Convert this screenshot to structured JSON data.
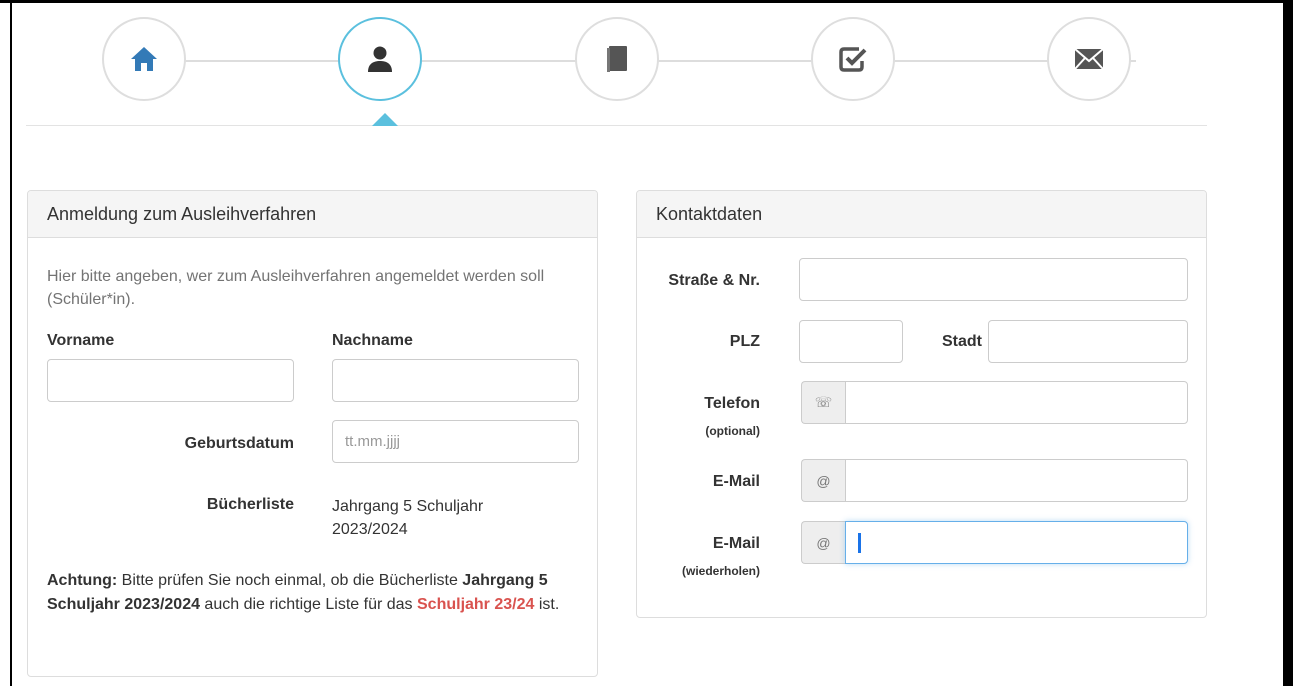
{
  "wizard": {
    "steps": [
      {
        "icon": "home-icon"
      },
      {
        "icon": "user-icon",
        "active": true
      },
      {
        "icon": "book-icon"
      },
      {
        "icon": "checkbox-icon"
      },
      {
        "icon": "envelope-icon"
      }
    ],
    "active_color": "#5bc0de"
  },
  "registration": {
    "heading": "Anmeldung zum Ausleihverfahren",
    "help_text": "Hier bitte angeben, wer zum Ausleihverfahren angemeldet werden soll (Schüler*in).",
    "firstname_label": "Vorname",
    "firstname_value": "",
    "lastname_label": "Nachname",
    "lastname_value": "",
    "birthdate_label": "Geburtsdatum",
    "birthdate_placeholder": "tt.mm.jjjj",
    "booklist_label": "Bücherliste",
    "booklist_value": "Jahrgang 5 Schuljahr 2023/2024",
    "warning": {
      "prefix": "Achtung:",
      "text1": " Bitte prüfen Sie noch einmal, ob die Bücherliste ",
      "list_name": "Jahrgang 5 Schuljahr 2023/2024",
      "text2": " auch die richtige Liste für das ",
      "year": "Schuljahr 23/24",
      "suffix": " ist."
    }
  },
  "contact": {
    "heading": "Kontaktdaten",
    "street_label": "Straße & Nr.",
    "zip_label": "PLZ",
    "city_label": "Stadt",
    "phone_label": "Telefon",
    "phone_hint": "(optional)",
    "phone_addon": "☏",
    "email_label": "E-Mail",
    "email_addon": "@",
    "email_repeat_label": "E-Mail",
    "email_repeat_hint": "(wiederholen)",
    "email_repeat_addon": "@"
  },
  "colors": {
    "primary": "#337ab7",
    "accent": "#5bc0de",
    "danger": "#d9534f",
    "icon_gray": "#555555"
  }
}
